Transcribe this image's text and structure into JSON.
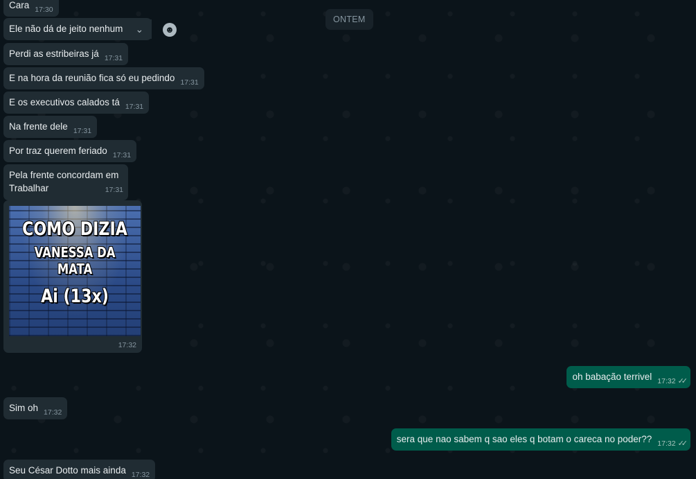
{
  "date_divider": "ONTEM",
  "incoming": [
    {
      "text": "Cara",
      "time": "17:30"
    },
    {
      "text": "Ele não dá de jeito nenhum",
      "time": ""
    },
    {
      "text": "Perdi as estribeiras já",
      "time": "17:31"
    },
    {
      "text": "E na hora da reunião fica só eu pedindo",
      "time": "17:31"
    },
    {
      "text": "E os executivos calados tá",
      "time": "17:31"
    },
    {
      "text": "Na frente dele",
      "time": "17:31"
    },
    {
      "text": "Por traz querem feriado",
      "time": "17:31"
    },
    {
      "text": "Pela frente concordam em Trabalhar",
      "line1": "Pela frente concordam em",
      "line2": "Trabalhar",
      "time": "17:31"
    },
    {
      "text": "Sim oh",
      "time": "17:32"
    },
    {
      "text": "Seu César Dotto mais ainda",
      "time": "17:32"
    }
  ],
  "media": {
    "line1": "COMO DIZIA",
    "line2": "VANESSA DA MATA",
    "line3": "Ai (13x)",
    "time": "17:32"
  },
  "outgoing": [
    {
      "text": "oh babação terrivel",
      "time": "17:32",
      "status": "read"
    },
    {
      "text": "sera que nao sabem q sao eles q botam o careca no poder??",
      "time": "17:32",
      "status": "read"
    }
  ],
  "icons": {
    "menu": "chevron-down-icon",
    "react": "emoji-icon",
    "read_receipt": "double-check-icon"
  },
  "colors": {
    "background": "#0b141a",
    "incoming_bubble": "#202c33",
    "outgoing_bubble": "#005c4b",
    "meta_text": "#8696a0"
  }
}
